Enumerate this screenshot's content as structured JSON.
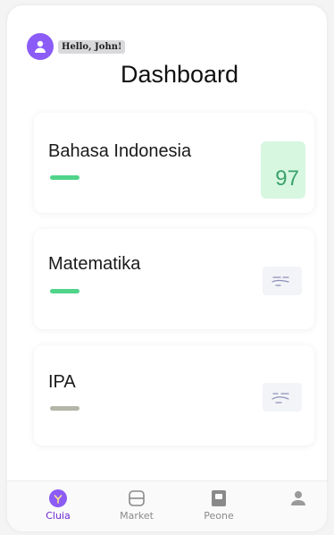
{
  "header": {
    "greeting": "Hello, John!",
    "title": "Dashboard",
    "avatar_icon": "user-icon"
  },
  "subjects": [
    {
      "name": "Bahasa Indonesia",
      "bar_color": "#4fd48a",
      "score": "97"
    },
    {
      "name": "Matematika",
      "bar_color": "#4fd48a",
      "thumbnail_icon": "doodle-icon"
    },
    {
      "name": "IPA",
      "bar_color": "#b5b5a8",
      "thumbnail_icon": "doodle-icon"
    }
  ],
  "bottom_nav": [
    {
      "label": "Cluia",
      "icon": "home-icon",
      "active": true
    },
    {
      "label": "Market",
      "icon": "market-icon",
      "active": false
    },
    {
      "label": "Peone",
      "icon": "badge-icon",
      "active": false
    },
    {
      "label": "",
      "icon": "profile-icon",
      "active": false
    }
  ],
  "colors": {
    "accent": "#8b5cf6",
    "success": "#4fd48a",
    "score_bg": "#d7f7e1"
  }
}
